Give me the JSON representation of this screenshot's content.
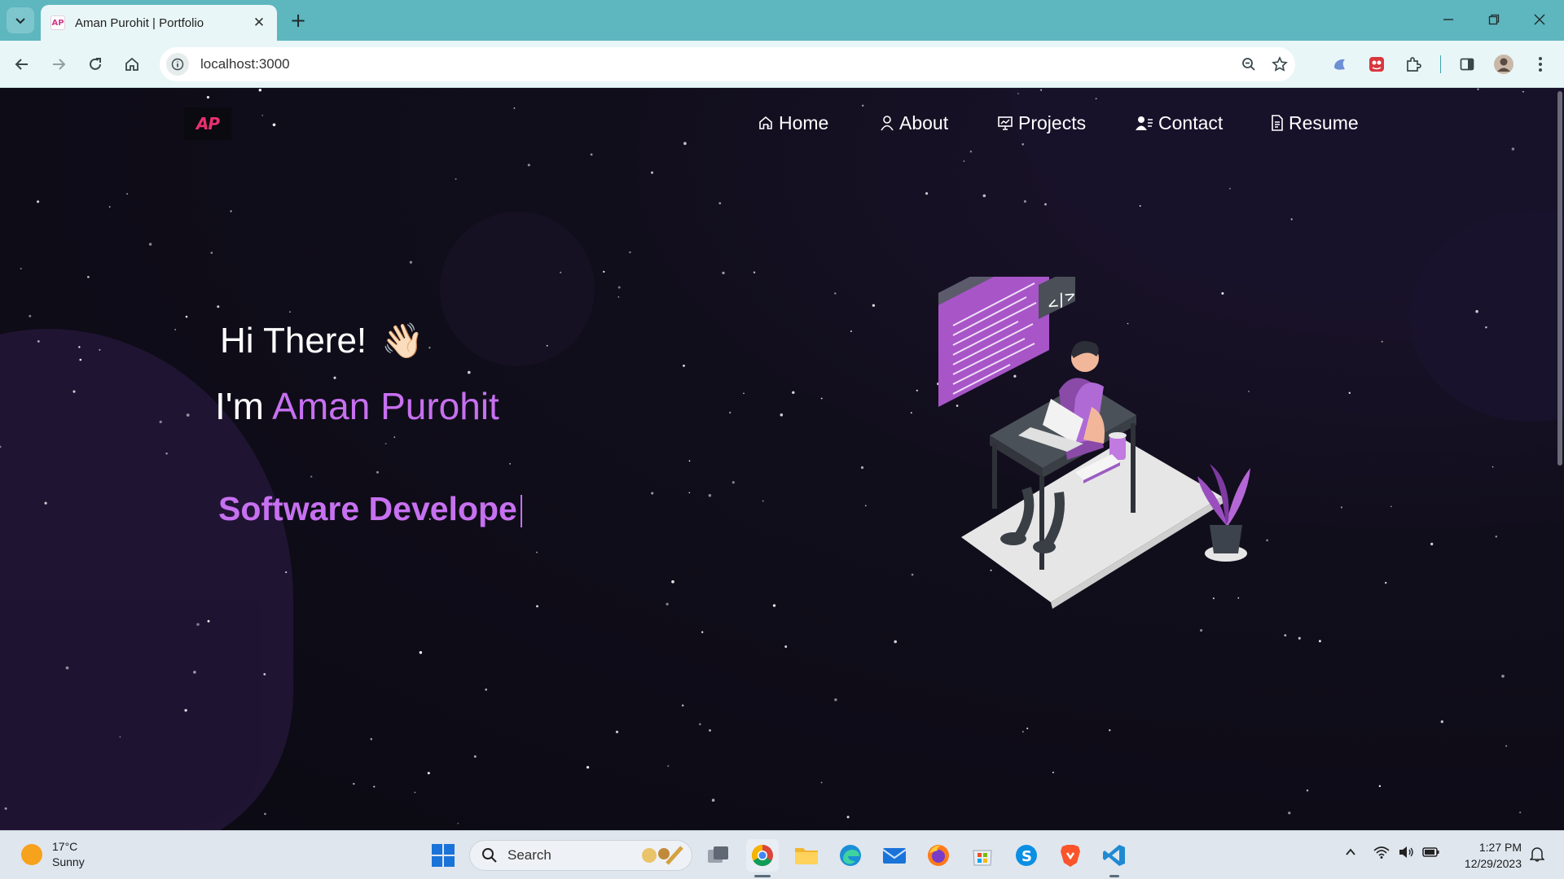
{
  "browser": {
    "tab_title": "Aman Purohit | Portfolio",
    "favicon_text": "AP",
    "url": "localhost:3000"
  },
  "site": {
    "logo": "AP",
    "nav": [
      {
        "label": "Home",
        "icon": "home-icon"
      },
      {
        "label": "About",
        "icon": "user-icon"
      },
      {
        "label": "Projects",
        "icon": "presentation-icon"
      },
      {
        "label": "Contact",
        "icon": "contact-icon"
      },
      {
        "label": "Resume",
        "icon": "document-icon"
      }
    ],
    "greeting": "Hi There!",
    "greeting_emoji": "👋🏻",
    "intro_prefix": "I'm",
    "name": "Aman Purohit",
    "role_typed": "Software Develope",
    "accent_color": "#c770f0",
    "logo_color": "#e8316f"
  },
  "taskbar": {
    "weather_temp": "17°C",
    "weather_cond": "Sunny",
    "search_label": "Search",
    "time": "1:27 PM",
    "date": "12/29/2023"
  }
}
